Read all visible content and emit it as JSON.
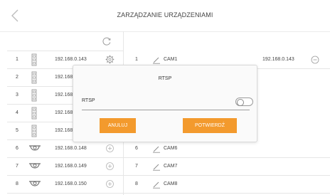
{
  "header": {
    "title": "ZARZĄDZANIE URZĄDZENIAMI"
  },
  "left_rows": [
    {
      "num": "1",
      "ip": "192.168.0.143",
      "device_icon": "nvr-box-icon",
      "action_icon": "gear-icon"
    },
    {
      "num": "2",
      "ip": "192.168",
      "device_icon": "nvr-box-icon",
      "action_icon": ""
    },
    {
      "num": "3",
      "ip": "192.168",
      "device_icon": "nvr-box-icon",
      "action_icon": ""
    },
    {
      "num": "4",
      "ip": "192.168",
      "device_icon": "nvr-box-icon",
      "action_icon": ""
    },
    {
      "num": "5",
      "ip": "192.168",
      "device_icon": "nvr-box-icon",
      "action_icon": ""
    },
    {
      "num": "6",
      "ip": "192.168.0.148",
      "device_icon": "dome-camera-icon",
      "action_icon": "add-circle-icon"
    },
    {
      "num": "7",
      "ip": "192.168.0.149",
      "device_icon": "dome-camera-icon",
      "action_icon": "add-circle-icon"
    },
    {
      "num": "8",
      "ip": "192.168.0.150",
      "device_icon": "dome-camera-icon",
      "action_icon": "add-circle-icon"
    }
  ],
  "right_rows": [
    {
      "num": "1",
      "name": "CAM1",
      "ip": "192.168.0.143",
      "has_remove": true
    },
    {
      "num": "6",
      "name": "CAM6",
      "ip": "",
      "has_remove": false
    },
    {
      "num": "7",
      "name": "CAM7",
      "ip": "",
      "has_remove": false
    },
    {
      "num": "8",
      "name": "CAM8",
      "ip": "",
      "has_remove": false
    }
  ],
  "modal": {
    "title": "RTSP",
    "toggle_label": "RTSP",
    "toggle_on": false,
    "cancel_label": "ANULUJ",
    "confirm_label": "POTWIERDŹ"
  },
  "colors": {
    "accent": "#f39a2d",
    "icon_gray": "#9a9a9a",
    "divider": "#e6e6e6"
  }
}
